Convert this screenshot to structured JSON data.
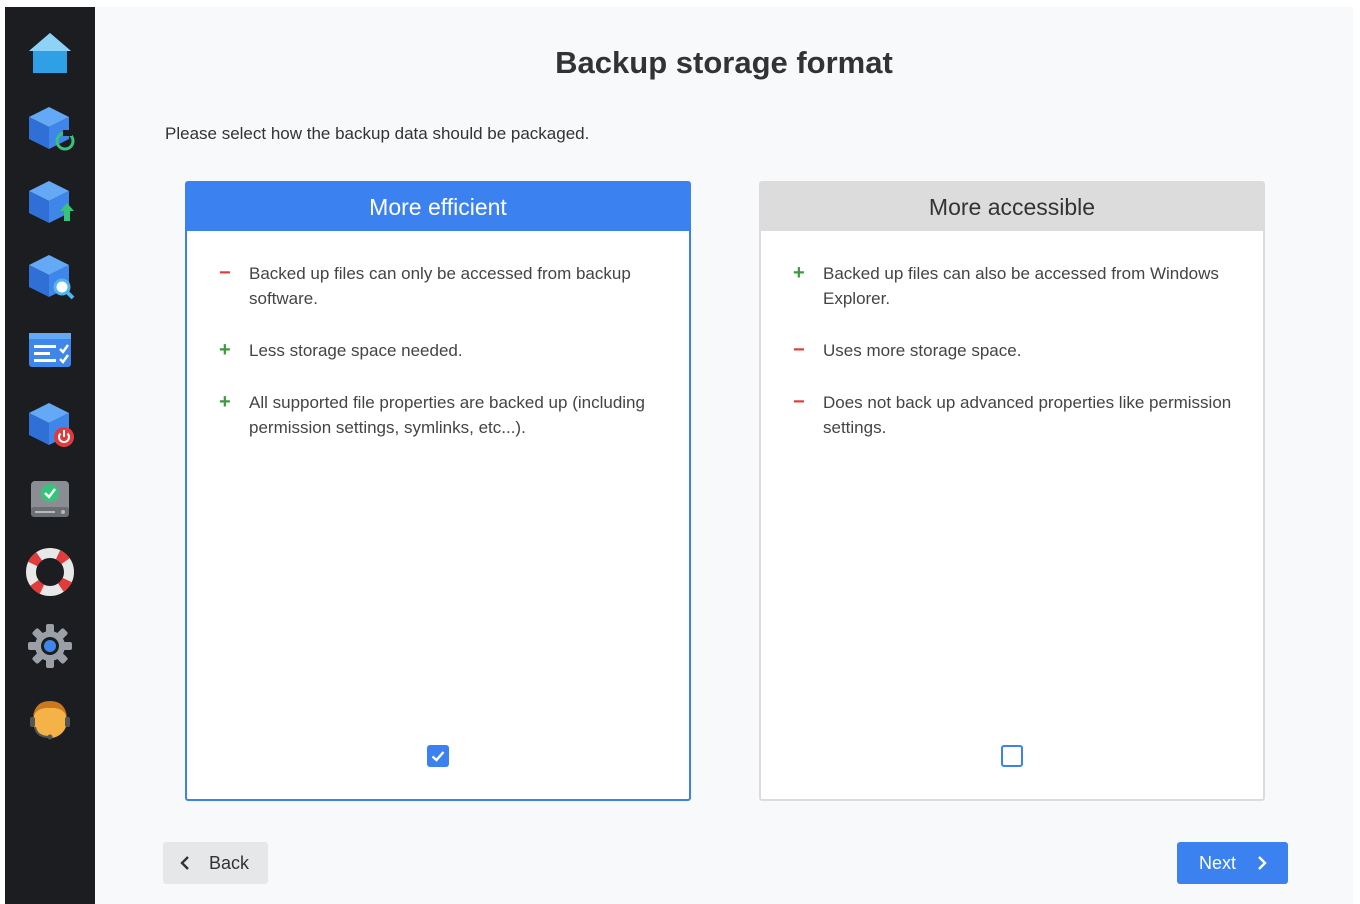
{
  "page": {
    "title": "Backup storage format",
    "subtitle": "Please select how the backup data should be packaged."
  },
  "sidebar": {
    "items": [
      {
        "icon": "home-icon"
      },
      {
        "icon": "backup-restore-icon"
      },
      {
        "icon": "backup-upload-icon"
      },
      {
        "icon": "backup-search-icon"
      },
      {
        "icon": "task-list-icon"
      },
      {
        "icon": "backup-power-icon"
      },
      {
        "icon": "disk-check-icon"
      },
      {
        "icon": "lifebuoy-icon"
      },
      {
        "icon": "gear-icon"
      },
      {
        "icon": "support-agent-icon"
      }
    ]
  },
  "options": {
    "efficient": {
      "title": "More efficient",
      "selected": true,
      "points": [
        {
          "sign": "−",
          "type": "minus",
          "text": "Backed up files can only be accessed from backup software."
        },
        {
          "sign": "+",
          "type": "plus",
          "text": "Less storage space needed."
        },
        {
          "sign": "+",
          "type": "plus",
          "text": "All supported file properties are backed up (including permission settings, symlinks, etc...)."
        }
      ]
    },
    "accessible": {
      "title": "More accessible",
      "selected": false,
      "points": [
        {
          "sign": "+",
          "type": "plus",
          "text": "Backed up files can also be accessed from Windows Explorer."
        },
        {
          "sign": "−",
          "type": "minus",
          "text": "Uses more storage space."
        },
        {
          "sign": "−",
          "type": "minus",
          "text": "Does not back up advanced properties like permission settings."
        }
      ]
    }
  },
  "buttons": {
    "back": "Back",
    "next": "Next"
  },
  "colors": {
    "accent": "#3b82f0",
    "plus": "#3e9a3e",
    "minus": "#e03c3c",
    "sidebar": "#1b1d20"
  }
}
